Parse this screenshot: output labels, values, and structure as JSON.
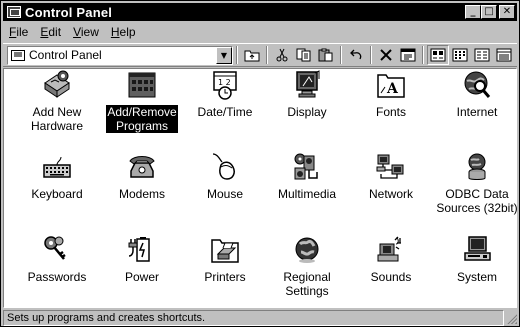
{
  "window": {
    "title": "Control Panel",
    "controls": {
      "minimize": "_",
      "maximize": "□",
      "close": "✕"
    }
  },
  "menubar": {
    "items": [
      {
        "label": "File",
        "accel": "F"
      },
      {
        "label": "Edit",
        "accel": "E"
      },
      {
        "label": "View",
        "accel": "V"
      },
      {
        "label": "Help",
        "accel": "H"
      }
    ]
  },
  "toolbar": {
    "address": "Control Panel",
    "buttons": [
      {
        "icon": "up-folder-icon"
      },
      {
        "icon": "cut-icon"
      },
      {
        "icon": "copy-icon"
      },
      {
        "icon": "paste-icon"
      },
      {
        "icon": "undo-icon"
      },
      {
        "icon": "delete-icon"
      },
      {
        "icon": "properties-icon"
      },
      {
        "icon": "large-icons-view-icon"
      },
      {
        "icon": "small-icons-view-icon"
      },
      {
        "icon": "list-view-icon"
      },
      {
        "icon": "details-view-icon"
      }
    ]
  },
  "items": [
    {
      "label": "Add New Hardware",
      "lines": [
        "Add New",
        "Hardware"
      ],
      "icon": "hardware-icon"
    },
    {
      "label": "Add/Remove Programs",
      "lines": [
        "Add/Remove",
        "Programs"
      ],
      "icon": "programs-icon",
      "selected": true
    },
    {
      "label": "Date/Time",
      "lines": [
        "Date/Time"
      ],
      "icon": "calendar-clock-icon"
    },
    {
      "label": "Display",
      "lines": [
        "Display"
      ],
      "icon": "monitor-icon"
    },
    {
      "label": "Fonts",
      "lines": [
        "Fonts"
      ],
      "icon": "fonts-folder-icon"
    },
    {
      "label": "Internet",
      "lines": [
        "Internet"
      ],
      "icon": "globe-magnifier-icon"
    },
    {
      "label": "Keyboard",
      "lines": [
        "Keyboard"
      ],
      "icon": "keyboard-icon"
    },
    {
      "label": "Modems",
      "lines": [
        "Modems"
      ],
      "icon": "phone-icon"
    },
    {
      "label": "Mouse",
      "lines": [
        "Mouse"
      ],
      "icon": "mouse-icon"
    },
    {
      "label": "Multimedia",
      "lines": [
        "Multimedia"
      ],
      "icon": "multimedia-icon"
    },
    {
      "label": "Network",
      "lines": [
        "Network"
      ],
      "icon": "network-icon"
    },
    {
      "label": "ODBC Data Sources (32bit)",
      "lines": [
        "ODBC Data",
        "Sources (32bit)"
      ],
      "icon": "database-icon"
    },
    {
      "label": "Passwords",
      "lines": [
        "Passwords"
      ],
      "icon": "keys-icon"
    },
    {
      "label": "Power",
      "lines": [
        "Power"
      ],
      "icon": "battery-plug-icon"
    },
    {
      "label": "Printers",
      "lines": [
        "Printers"
      ],
      "icon": "printer-folder-icon"
    },
    {
      "label": "Regional Settings",
      "lines": [
        "Regional",
        "Settings"
      ],
      "icon": "earth-icon"
    },
    {
      "label": "Sounds",
      "lines": [
        "Sounds"
      ],
      "icon": "speaker-icon"
    },
    {
      "label": "System",
      "lines": [
        "System"
      ],
      "icon": "computer-icon"
    }
  ],
  "statusbar": {
    "text": "Sets up programs and creates shortcuts."
  }
}
